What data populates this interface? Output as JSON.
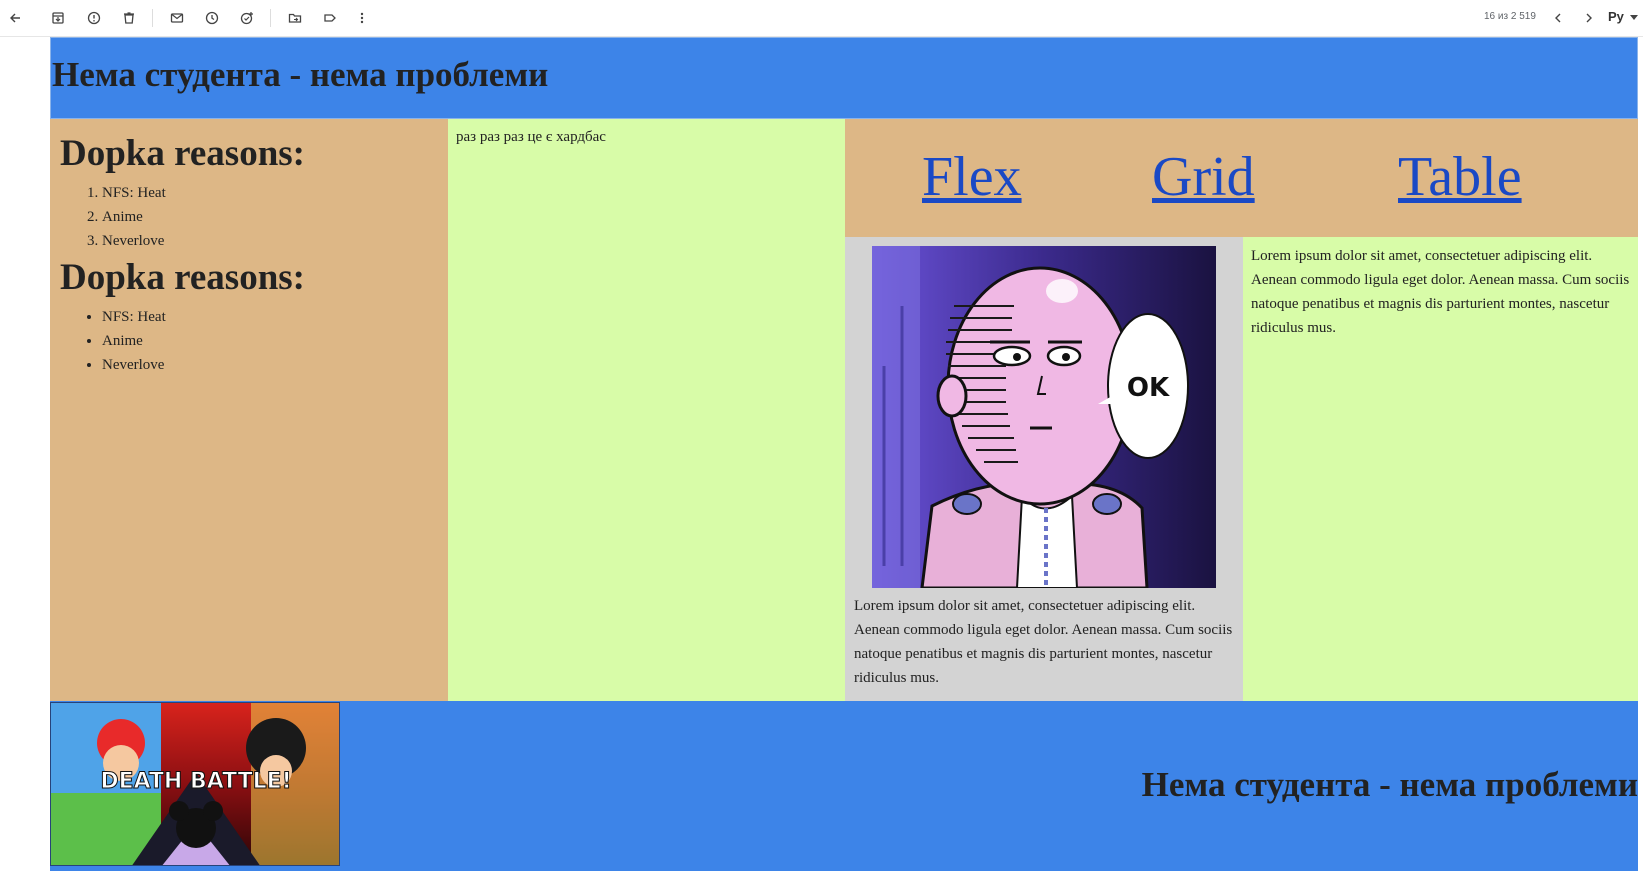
{
  "toolbar": {
    "counter": "16 из 2 519",
    "language": "Ру",
    "icons": [
      "back-arrow-icon",
      "archive-icon",
      "report-spam-icon",
      "delete-icon",
      "mark-unread-icon",
      "snooze-icon",
      "add-task-icon",
      "move-to-icon",
      "label-icon",
      "more-vert-icon",
      "prev-icon",
      "next-icon"
    ]
  },
  "header": {
    "title": "Нема студента - нема проблеми"
  },
  "sidebar": {
    "heading1": "Dopka reasons:",
    "ordered_items": [
      "NFS: Heat",
      "Anime",
      "Neverlove"
    ],
    "heading2": "Dopka reasons:",
    "unordered_items": [
      "NFS: Heat",
      "Anime",
      "Neverlove"
    ]
  },
  "middle": {
    "text": "раз раз раз це є хардбас"
  },
  "nav": {
    "links": [
      "Flex",
      "Grid",
      "Table"
    ]
  },
  "card": {
    "bubble_text": "OK",
    "text": "Lorem ipsum dolor sit amet, consectetuer adipiscing elit. Aenean commodo ligula eget dolor. Aenean massa. Cum sociis natoque penatibus et magnis dis parturient montes, nascetur ridiculus mus."
  },
  "side_text": {
    "text": "Lorem ipsum dolor sit amet, consectetuer adipiscing elit. Aenean commodo ligula eget dolor. Aenean massa. Cum sociis natoque penatibus et magnis dis parturient montes, nascetur ridiculus mus."
  },
  "footer": {
    "banner_text": "DEATH BATTLE!",
    "title": "Нема студента - нема проблеми"
  },
  "colors": {
    "header_blue": "#3d84e8",
    "tan": "#ddb786",
    "light_green": "#d8fca8",
    "gray": "#d3d3d3",
    "link_blue": "#1a49c5"
  }
}
